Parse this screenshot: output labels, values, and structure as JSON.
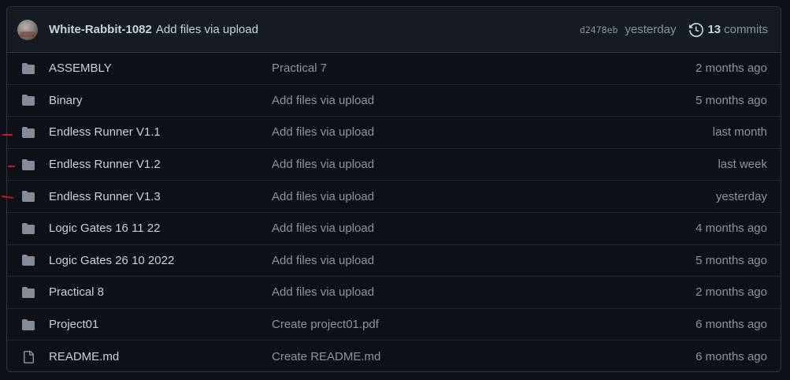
{
  "header": {
    "author": "White-Rabbit-1082",
    "commit_message": "Add files via upload",
    "sha": "d2478eb",
    "time": "yesterday",
    "commit_count": "13",
    "commits_label": "commits"
  },
  "files": [
    {
      "name": "ASSEMBLY",
      "type": "folder",
      "message": "Practical 7",
      "age": "2 months ago"
    },
    {
      "name": "Binary",
      "type": "folder",
      "message": "Add files via upload",
      "age": "5 months ago"
    },
    {
      "name": "Endless Runner V1.1",
      "type": "folder",
      "message": "Add files via upload",
      "age": "last month"
    },
    {
      "name": "Endless Runner V1.2",
      "type": "folder",
      "message": "Add files via upload",
      "age": "last week"
    },
    {
      "name": "Endless Runner V1.3",
      "type": "folder",
      "message": "Add files via upload",
      "age": "yesterday"
    },
    {
      "name": "Logic Gates 16 11 22",
      "type": "folder",
      "message": "Add files via upload",
      "age": "4 months ago"
    },
    {
      "name": "Logic Gates 26 10 2022",
      "type": "folder",
      "message": "Add files via upload",
      "age": "5 months ago"
    },
    {
      "name": "Practical 8",
      "type": "folder",
      "message": "Add files via upload",
      "age": "2 months ago"
    },
    {
      "name": "Project01",
      "type": "folder",
      "message": "Create project01.pdf",
      "age": "6 months ago"
    },
    {
      "name": "README.md",
      "type": "file",
      "message": "Create README.md",
      "age": "6 months ago"
    }
  ],
  "colors": {
    "background": "#0d1117",
    "header_bg": "#161b22",
    "border": "#30363d",
    "text": "#c9d1d9",
    "muted": "#8b949e",
    "icon": "#848d97",
    "annotation_marker": "#d0141b"
  }
}
